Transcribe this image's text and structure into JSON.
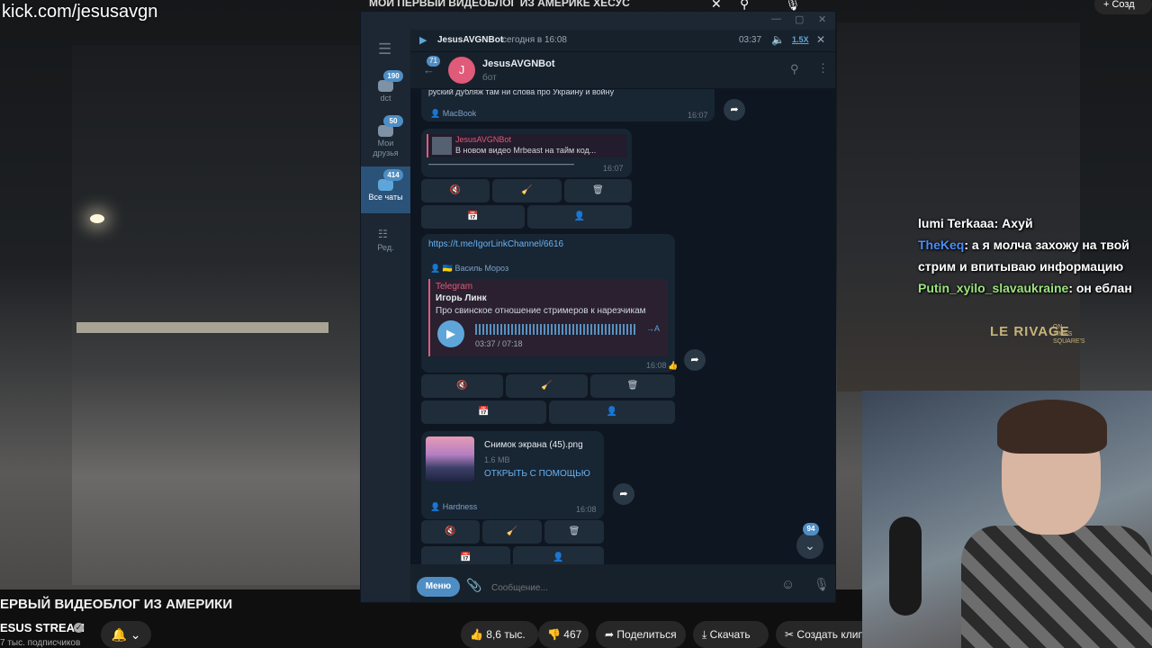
{
  "stream": {
    "channel_url": "kick.com/jesusavgn",
    "top_title": "МОЙ ПЕРВЫЙ ВИДЕОБЛОГ ИЗ АМЕРИКЕ ХЕСУС",
    "create_label": "Созд",
    "chat": [
      {
        "user": "lumi Terkaaa",
        "text": ": Ахуй",
        "color": "#ffffff"
      },
      {
        "user": "TheKeq",
        "text": ": а я молча захожу на твой стрим и впитываю информацию",
        "color": "#4b8df8"
      },
      {
        "user": "Putin_xyilo_slavaukraine",
        "text": ": он еблан",
        "color": "#9be37c"
      }
    ],
    "sign_text": "LE RIVAGE",
    "sign_sub": "ON TIMES SQUARE'S"
  },
  "youtube": {
    "video_title": "ЕРВЫЙ ВИДЕОБЛОГ ИЗ АМЕРИКИ",
    "channel_name": "ESUS STREAM",
    "subscribers": "7 тыс. подписчиков",
    "likes": "8,6 тыс.",
    "dislikes": "467",
    "share_label": "Поделиться",
    "download_label": "Скачать",
    "clip_label": "Создать клип"
  },
  "telegram": {
    "folders": [
      {
        "label": "dct",
        "badge": "190"
      },
      {
        "label": "Мои друзья",
        "badge": "50"
      },
      {
        "label": "Все чаты",
        "badge": "414"
      },
      {
        "label": "Ред.",
        "badge": ""
      }
    ],
    "player": {
      "title": "JesusAVGNBot",
      "subtitle": "сегодня в 16:08",
      "time": "03:37",
      "speed": "1.5X"
    },
    "header": {
      "back_badge": "71",
      "avatar_letter": "J",
      "name": "JesusAVGNBot",
      "status": "бот"
    },
    "messages": {
      "m1": {
        "text": "руский дубляж там ни слова про Украину и войну",
        "sig": "MacBook",
        "time": "16:07"
      },
      "m2": {
        "reply_name": "JesusAVGNBot",
        "reply_text": "В новом видео Mrbeast на тайм код...",
        "dashes": "——————————————————",
        "time": "16:07"
      },
      "m3": {
        "link": "https://t.me/IgorLinkChannel/6616",
        "sig": "Василь Мороз",
        "src": "Telegram",
        "author": "Игорь Линк",
        "desc": "Про свинское отношение стримеров к нарезчикам",
        "audio_time": "03:37 / 07:18",
        "transcribe": "→A",
        "time": "16:08"
      },
      "m4": {
        "file_name": "Снимок экрана (45).png",
        "file_size": "1.6 MB",
        "open_with": "ОТКРЫТЬ С ПОМОЩЬЮ",
        "sig": "Hardness",
        "time": "16:08"
      }
    },
    "keyboard_icons": [
      "🔇",
      "🧹",
      "🗑",
      "📅",
      "👤"
    ],
    "unread_count": "94",
    "menu_label": "Меню",
    "input_placeholder": "Сообщение..."
  }
}
